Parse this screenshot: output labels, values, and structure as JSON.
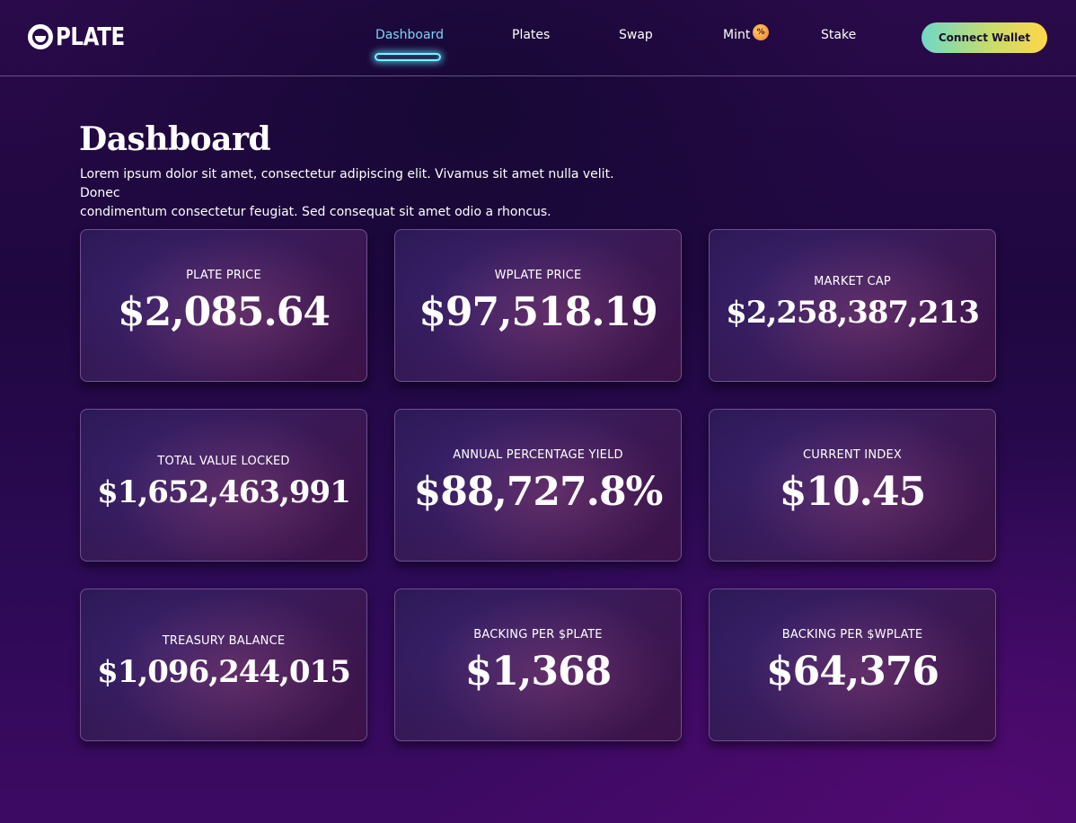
{
  "header": {
    "logo_text": "PLATE",
    "nav": {
      "dashboard": "Dashboard",
      "plates": "Plates",
      "swap": "Swap",
      "mint": "Mint",
      "stake": "Stake"
    },
    "mint_badge": "%",
    "connect_label": "Connect Wallet",
    "active_item": "Dashboard"
  },
  "intro": {
    "title": "Dashboard",
    "line1": "Lorem ipsum dolor sit amet, consectetur adipiscing elit. Vivamus sit amet nulla velit. Donec",
    "line2": "condimentum consectetur feugiat. Sed consequat sit amet odio a rhoncus."
  },
  "stats": {
    "plate_price": {
      "label": "PLATE PRICE",
      "value": "$2,085.64"
    },
    "wplate_price": {
      "label": "WPLATE PRICE",
      "value": "$97,518.19"
    },
    "market_cap": {
      "label": "MARKET CAP",
      "value": "$2,258,387,213"
    },
    "tvl": {
      "label": "TOTAL VALUE LOCKED",
      "value": "$1,652,463,991"
    },
    "apy": {
      "label": "ANNUAL PERCENTAGE YIELD",
      "value": "$88,727.8%"
    },
    "current_index": {
      "label": "CURRENT INDEX",
      "value": "$10.45"
    },
    "treasury_balance": {
      "label": "TREASURY BALANCE",
      "value": "$1,096,244,015"
    },
    "backing_plate": {
      "label": "BACKING PER $PLATE",
      "value": "$1,368"
    },
    "backing_wplate": {
      "label": "BACKING PER $WPLATE",
      "value": "$64,376"
    }
  },
  "colors": {
    "accent_cyan": "#7af3ff",
    "button_gradient_start": "#6fd8c8",
    "button_gradient_end": "#ffd64a",
    "background": "#2a0a4a"
  }
}
